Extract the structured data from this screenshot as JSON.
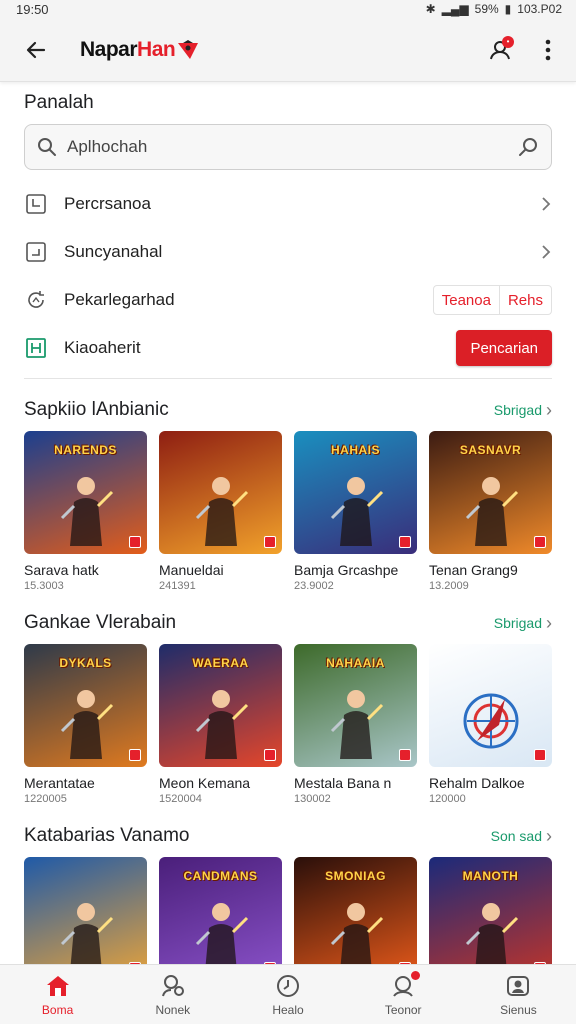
{
  "status": {
    "time": "19:50",
    "battery": "59%",
    "right_text": "103.P02"
  },
  "app_bar": {
    "brand_part1": "Napar",
    "brand_part2": "Han"
  },
  "section_label": "Panalah",
  "search": {
    "placeholder": "Aplhochah"
  },
  "menu": [
    {
      "label": "Percrsanoa",
      "icon": "library-icon",
      "trailing": "chevron"
    },
    {
      "label": "Suncyanahal",
      "icon": "note-icon",
      "trailing": "chevron"
    },
    {
      "label": "Pekarlegarhad",
      "icon": "refresh-icon",
      "chips": [
        "Teanoa",
        "Rehs"
      ]
    },
    {
      "label": "Kiaoaherit",
      "icon": "app-icon",
      "button": "Pencarian"
    }
  ],
  "categories": [
    {
      "title": "Sapkiio lAnbianic",
      "more": "Sbrigad",
      "items": [
        {
          "title": "Sarava hatk",
          "sub": "15.3003",
          "art": "NARENDS",
          "bg1": "#1b3f8f",
          "bg2": "#e35d1a"
        },
        {
          "title": "Manueldai",
          "sub": "241391",
          "art": "",
          "bg1": "#8e1e12",
          "bg2": "#f2a22b"
        },
        {
          "title": "Bamja Grcashpe",
          "sub": "23.9002",
          "art": "HAHAIS",
          "bg1": "#1a8fbf",
          "bg2": "#3a2d7a"
        },
        {
          "title": "Tenan Grang9",
          "sub": "13.2009",
          "art": "SASNAVR",
          "bg1": "#3b1b12",
          "bg2": "#f08a2a"
        }
      ]
    },
    {
      "title": "Gankae Vlerabain",
      "more": "Sbrigad",
      "items": [
        {
          "title": "Merantatae",
          "sub": "1220005",
          "art": "DYKALS",
          "bg1": "#2e3a4a",
          "bg2": "#e07a1f"
        },
        {
          "title": "Meon Kemana",
          "sub": "1520004",
          "art": "WAERAA",
          "bg1": "#1e2c6a",
          "bg2": "#e6462a"
        },
        {
          "title": "Mestala Bana n",
          "sub": "130002",
          "art": "NAHAAIA",
          "bg1": "#3d6a2a",
          "bg2": "#a9c6c8"
        },
        {
          "title": "Rehalm Dalkoe",
          "sub": "120000",
          "art": "",
          "bg1": "#ffffff",
          "bg2": "#d9e7f4"
        }
      ]
    },
    {
      "title": "Katabarias Vanamo",
      "more": "Son sad",
      "items": [
        {
          "title": "",
          "sub": "",
          "art": "",
          "bg1": "#1f5aa8",
          "bg2": "#e8a33a"
        },
        {
          "title": "",
          "sub": "",
          "art": "CANDMANS",
          "bg1": "#4a1f7a",
          "bg2": "#8a52c9"
        },
        {
          "title": "",
          "sub": "",
          "art": "SMONIAG",
          "bg1": "#2a0f0a",
          "bg2": "#e85a1a"
        },
        {
          "title": "",
          "sub": "",
          "art": "MANOTH",
          "bg1": "#1b2a7a",
          "bg2": "#c0352a"
        }
      ]
    }
  ],
  "bottom_nav": [
    {
      "label": "Boma",
      "icon": "home-icon",
      "active": true
    },
    {
      "label": "Nonek",
      "icon": "people-icon",
      "active": false
    },
    {
      "label": "Healo",
      "icon": "compass-icon",
      "active": false
    },
    {
      "label": "Teonor",
      "icon": "chat-icon",
      "active": false,
      "dot": true
    },
    {
      "label": "Sienus",
      "icon": "profile-icon",
      "active": false
    }
  ],
  "colors": {
    "accent": "#e5202b",
    "link": "#1a9a6c"
  }
}
